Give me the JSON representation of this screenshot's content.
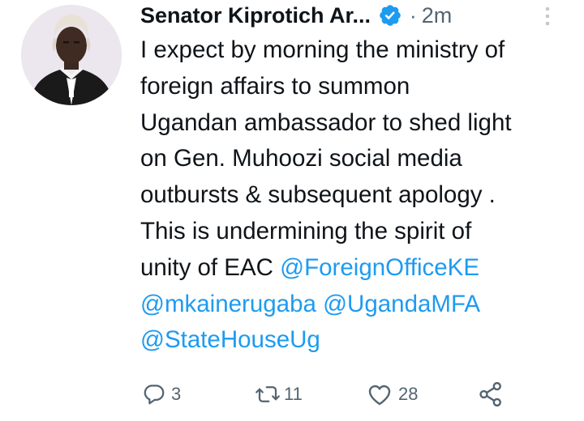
{
  "author": {
    "name": "Senator Kiprotich Ar...",
    "verified_icon": "verified-badge-icon",
    "dot": "·",
    "time": "2m"
  },
  "tweet": {
    "segments": [
      "I expect by morning the ministry of",
      "foreign affairs to summon",
      "Ugandan ambassador to shed light",
      "on Gen. Muhoozi social media",
      "outbursts & subsequent apology .",
      "This is undermining the spirit of",
      "unity of EAC "
    ],
    "mentions": [
      "@ForeignOfficeKE",
      "@mkainerugaba",
      "@UgandaMFA",
      "@StateHouseUg"
    ]
  },
  "actions": {
    "reply": {
      "icon": "reply-icon",
      "count": "3"
    },
    "retweet": {
      "icon": "retweet-icon",
      "count": "11"
    },
    "like": {
      "icon": "heart-icon",
      "count": "28"
    },
    "share": {
      "icon": "share-icon"
    }
  },
  "colors": {
    "text": "#0f1419",
    "secondary": "#536471",
    "link": "#1d9bf0",
    "verified": "#1d9bf0"
  }
}
